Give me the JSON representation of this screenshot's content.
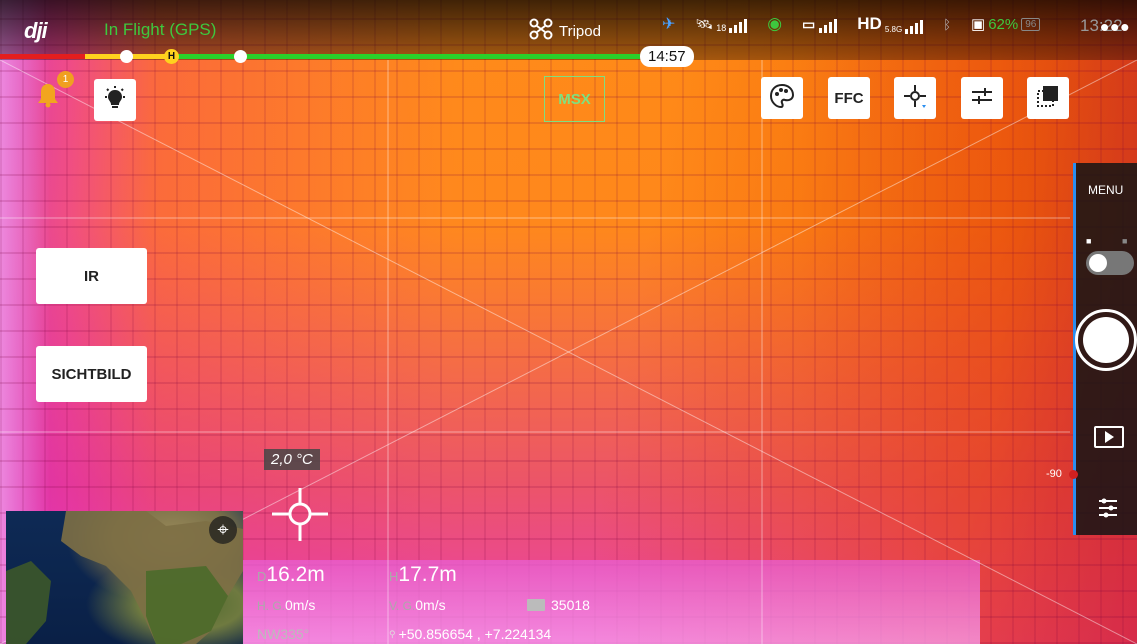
{
  "app": {
    "logo": "dji"
  },
  "status_bar": {
    "flight_status": "In Flight (GPS)",
    "flight_mode": "Tripod",
    "gps_satellites": "18",
    "hd_band": "5.8G",
    "battery_percent": "62%",
    "battery_box": "96",
    "time": "13:22"
  },
  "flight_bar": {
    "home_marker": "H",
    "remaining_time": "14:57"
  },
  "camera": {
    "notification_count": "1",
    "display_mode": "MSX",
    "ffc_label": "FFC",
    "ir_button": "IR",
    "visible_button": "SICHTBILD",
    "spot_temperature": "2,0 °C"
  },
  "right_panel": {
    "menu_label": "MENU",
    "gimbal_min": "-90"
  },
  "telemetry": {
    "distance_prefix": "D",
    "distance": "16.2m",
    "height_prefix": "H",
    "height": "17.7m",
    "hspeed_prefix": "H. G.",
    "hspeed": "0m/s",
    "vspeed_prefix": "V. G.",
    "vspeed": "0m/s",
    "storage_count": "35018",
    "heading": "NW335°",
    "coordinates": "+50.856654 , +7.224134"
  },
  "colors": {
    "accent_green": "#3ec83e",
    "progress_red": "#e41e1e",
    "progress_yellow": "#ffd21e",
    "progress_green": "#2ad12a",
    "panel_blue": "#2a8ef0"
  }
}
